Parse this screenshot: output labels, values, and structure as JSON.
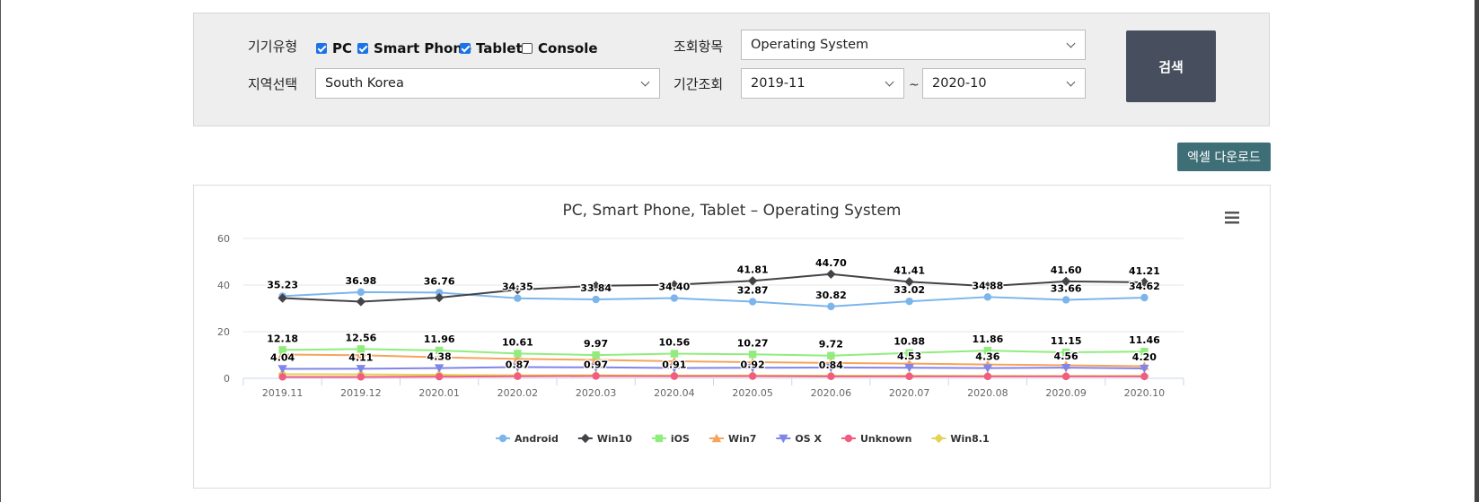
{
  "filters": {
    "device_type_label": "기기유형",
    "devices": [
      {
        "label": "PC",
        "checked": true
      },
      {
        "label": "Smart Phone",
        "checked": true
      },
      {
        "label": "Tablet",
        "checked": true
      },
      {
        "label": "Console",
        "checked": false
      }
    ],
    "query_item_label": "조회항목",
    "query_item_value": "Operating System",
    "region_label": "지역선택",
    "region_value": "South Korea",
    "period_label": "기간조회",
    "period_start": "2019-11",
    "period_separator": "~",
    "period_end": "2020-10",
    "search_label": "검색"
  },
  "excel_label": "엑셀 다운로드",
  "colors": {
    "accent_dark": "#474f5e",
    "excel": "#3e6e76"
  },
  "chart_data": {
    "type": "line",
    "title": "PC, Smart Phone, Tablet – Operating System",
    "xlabel": "",
    "ylabel": "",
    "ylim": [
      0,
      60
    ],
    "yticks": [
      0,
      20,
      40,
      60
    ],
    "grid": true,
    "legend_position": "bottom",
    "categories": [
      "2019.11",
      "2019.12",
      "2020.01",
      "2020.02",
      "2020.03",
      "2020.04",
      "2020.05",
      "2020.06",
      "2020.07",
      "2020.08",
      "2020.09",
      "2020.10"
    ],
    "series": [
      {
        "name": "Android",
        "color": "#7cb5ec",
        "marker": "circle",
        "values": [
          35.23,
          36.98,
          36.76,
          34.35,
          33.84,
          34.4,
          32.87,
          30.82,
          33.02,
          34.88,
          33.66,
          34.62
        ],
        "labels": [
          true,
          true,
          true,
          true,
          true,
          true,
          true,
          true,
          true,
          true,
          true,
          true
        ]
      },
      {
        "name": "Win10",
        "color": "#434348",
        "marker": "diamond",
        "values": [
          34.4,
          32.9,
          34.6,
          38.0,
          39.7,
          40.1,
          41.81,
          44.7,
          41.41,
          39.5,
          41.6,
          41.21
        ],
        "labels": [
          false,
          false,
          false,
          false,
          false,
          false,
          true,
          true,
          true,
          false,
          true,
          true
        ]
      },
      {
        "name": "iOS",
        "color": "#90ed7d",
        "marker": "square",
        "values": [
          12.18,
          12.56,
          11.96,
          10.61,
          9.97,
          10.56,
          10.27,
          9.72,
          10.88,
          11.86,
          11.15,
          11.46
        ],
        "labels": [
          true,
          true,
          true,
          true,
          true,
          true,
          true,
          true,
          true,
          true,
          true,
          true
        ]
      },
      {
        "name": "Win7",
        "color": "#f7a35c",
        "marker": "triangle",
        "values": [
          10.2,
          9.9,
          9.0,
          8.3,
          7.9,
          7.3,
          6.9,
          6.6,
          6.3,
          5.9,
          5.6,
          5.2
        ],
        "labels": [
          false,
          false,
          false,
          false,
          false,
          false,
          false,
          false,
          false,
          false,
          false,
          false
        ]
      },
      {
        "name": "OS X",
        "color": "#8085e9",
        "marker": "triangle-down",
        "values": [
          4.04,
          4.11,
          4.38,
          4.8,
          4.7,
          4.4,
          4.5,
          4.6,
          4.53,
          4.36,
          4.56,
          4.2
        ],
        "labels": [
          true,
          true,
          true,
          false,
          false,
          false,
          false,
          false,
          true,
          true,
          true,
          true
        ]
      },
      {
        "name": "Unknown",
        "color": "#f15c80",
        "marker": "circle",
        "values": [
          0.6,
          0.6,
          0.7,
          0.87,
          0.97,
          0.91,
          0.92,
          0.84,
          0.8,
          0.8,
          0.8,
          0.8
        ],
        "labels": [
          false,
          false,
          false,
          true,
          true,
          true,
          true,
          true,
          false,
          false,
          false,
          false
        ]
      },
      {
        "name": "Win8.1",
        "color": "#e4d354",
        "marker": "diamond",
        "values": [
          1.8,
          1.7,
          1.5,
          1.3,
          1.3,
          1.2,
          1.2,
          1.1,
          1.1,
          1.0,
          1.0,
          1.0
        ],
        "labels": [
          false,
          false,
          false,
          false,
          false,
          false,
          false,
          false,
          false,
          false,
          false,
          false
        ]
      }
    ]
  }
}
